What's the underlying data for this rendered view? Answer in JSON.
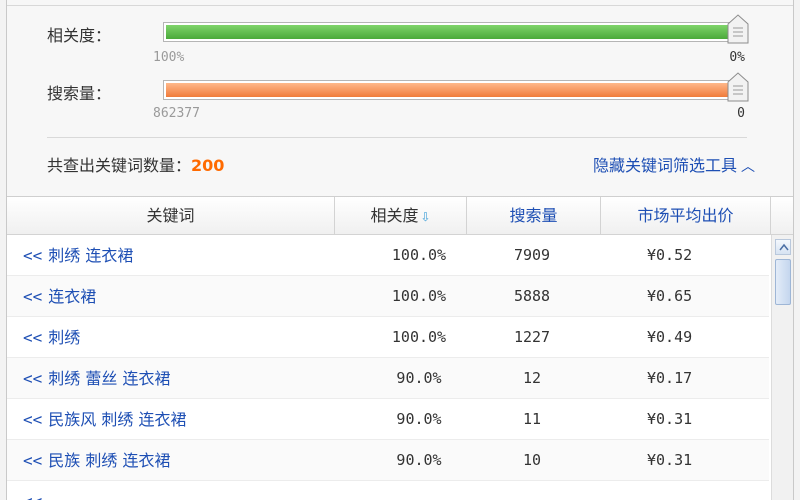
{
  "filters": {
    "relevance": {
      "label": "相关度：",
      "min_label": "100%",
      "max_label": "0%",
      "fill_fraction": 1.0,
      "color": "#4aa93a"
    },
    "search_volume": {
      "label": "搜索量：",
      "min_label": "862377",
      "max_label": "0",
      "fill_fraction": 1.0,
      "color": "#f07b3a"
    }
  },
  "summary": {
    "count_label": "共查出关键词数量：",
    "count_value": "200",
    "hide_tools_label": "隐藏关键词筛选工具",
    "hide_tools_icon": "chevron-up-icon"
  },
  "table": {
    "headers": {
      "keyword": "关键词",
      "relevance": "相关度",
      "relevance_sort_icon": "sort-down-icon",
      "volume": "搜索量",
      "price": "市场平均出价"
    },
    "add_icon_glyph": "<<",
    "rows": [
      {
        "keyword": "刺绣 连衣裙",
        "relevance": "100.0%",
        "volume": "7909",
        "price": "¥0.52"
      },
      {
        "keyword": "连衣裙",
        "relevance": "100.0%",
        "volume": "5888",
        "price": "¥0.65"
      },
      {
        "keyword": "刺绣",
        "relevance": "100.0%",
        "volume": "1227",
        "price": "¥0.49"
      },
      {
        "keyword": "刺绣 蕾丝 连衣裙",
        "relevance": "90.0%",
        "volume": "12",
        "price": "¥0.17"
      },
      {
        "keyword": "民族风 刺绣 连衣裙",
        "relevance": "90.0%",
        "volume": "11",
        "price": "¥0.31"
      },
      {
        "keyword": "民族 刺绣 连衣裙",
        "relevance": "90.0%",
        "volume": "10",
        "price": "¥0.31"
      },
      {
        "keyword": "",
        "relevance": "",
        "volume": "",
        "price": ""
      }
    ]
  }
}
